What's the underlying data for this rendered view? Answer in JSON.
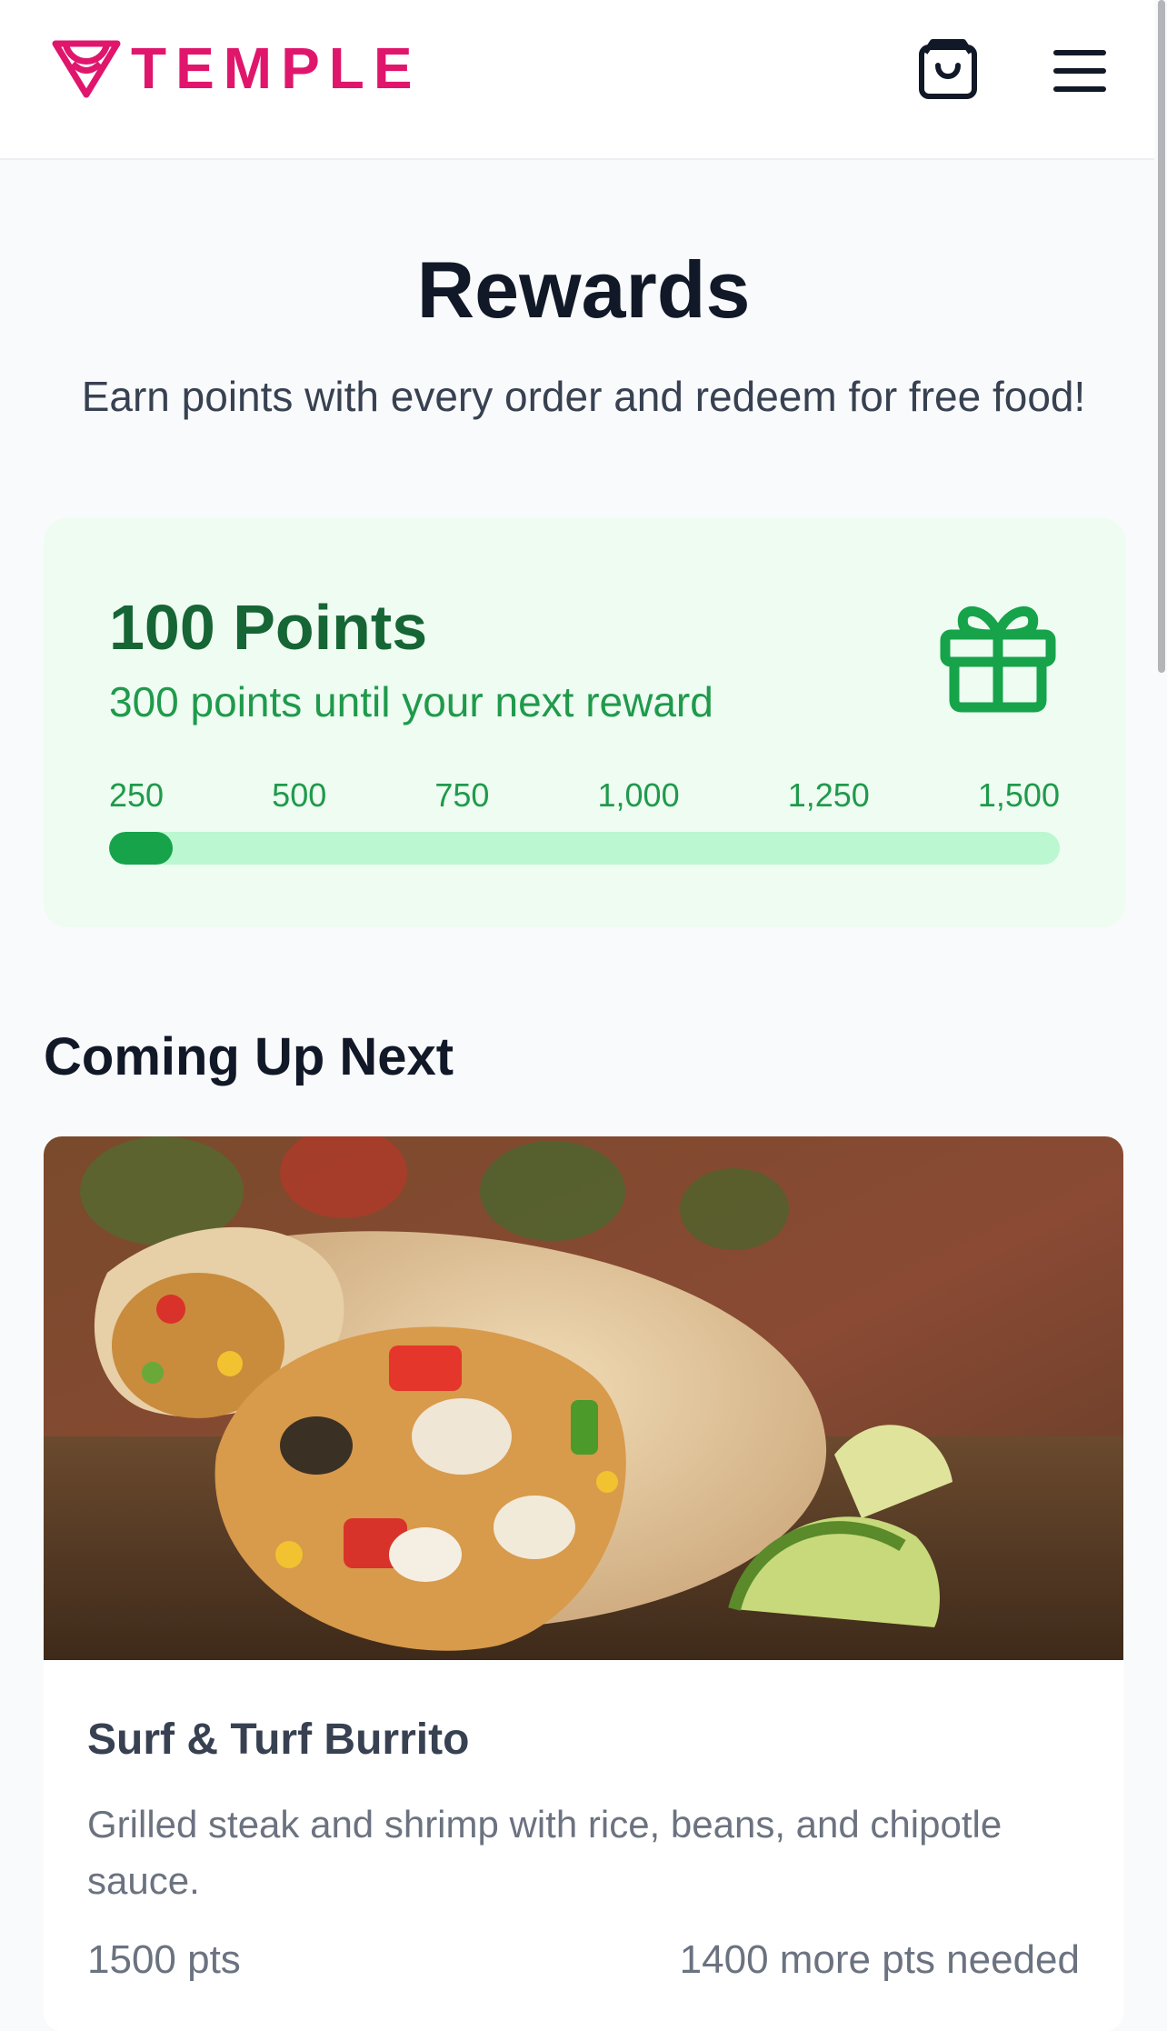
{
  "header": {
    "brand": "TEMPLE",
    "icons": {
      "logo": "temple-logo-icon",
      "cart": "shopping-bag-icon",
      "menu": "hamburger-menu-icon"
    },
    "brand_color": "#e0166d"
  },
  "page": {
    "title": "Rewards",
    "subtitle": "Earn points with every order and redeem for free food!"
  },
  "points": {
    "total_label": "100 Points",
    "until_next": "300 points until your next reward",
    "icon": "gift-icon",
    "ticks": [
      "250",
      "500",
      "750",
      "1,000",
      "1,250",
      "1,500"
    ],
    "progress_percent": 6.7,
    "accent_color": "#16a34a"
  },
  "coming_up": {
    "title": "Coming Up Next",
    "reward": {
      "name": "Surf & Turf Burrito",
      "description": "Grilled steak and shrimp with rice, beans, and chipotle sauce.",
      "points": "1500 pts",
      "needed": "1400 more pts needed"
    }
  }
}
